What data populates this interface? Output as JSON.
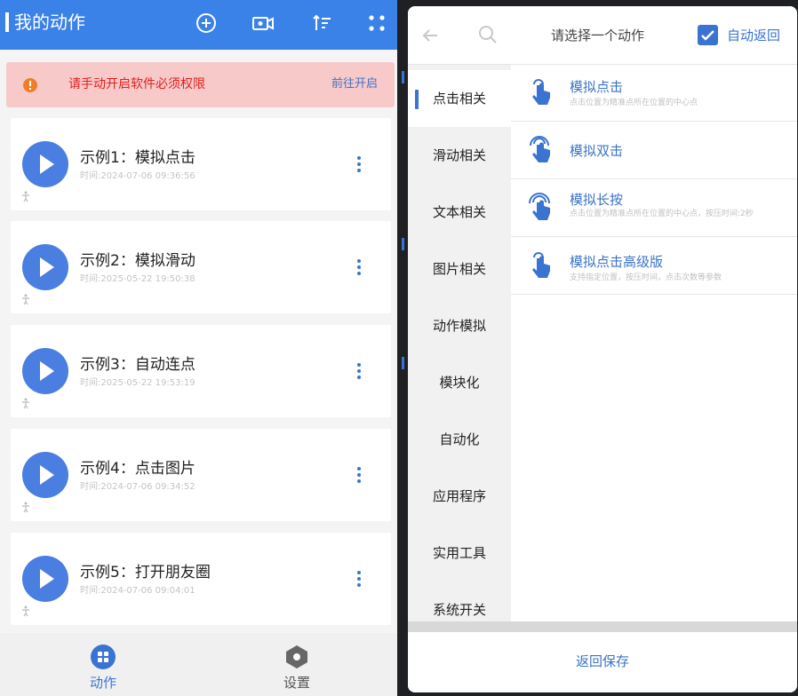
{
  "left": {
    "header": {
      "title": "我的动作",
      "icons": [
        "plus-circle-icon",
        "record-video-icon",
        "sort-icon",
        "grid-dots-icon"
      ]
    },
    "warning": {
      "icon": "exclamation-icon",
      "text": "请手动开启软件必须权限",
      "link": "前往开启",
      "colors": {
        "background": "#f8c9c9",
        "text": "#e0201f",
        "link": "#3b74c4"
      }
    },
    "tasks": [
      {
        "title": "示例1：模拟点击",
        "time": "时间:2024-07-06 09:36:56"
      },
      {
        "title": "示例2：模拟滑动",
        "time": "时间:2025-05-22 19:50:38"
      },
      {
        "title": "示例3：自动连点",
        "time": "时间:2025-05-22 19:53:19"
      },
      {
        "title": "示例4：点击图片",
        "time": "时间:2024-07-06 09:34:52"
      },
      {
        "title": "示例5：打开朋友圈",
        "time": "时间:2024-07-06 09:04:01"
      }
    ],
    "nav": [
      {
        "label": "动作",
        "icon": "actions-grid-icon",
        "active": true
      },
      {
        "label": "设置",
        "icon": "settings-hex-icon",
        "active": false
      }
    ],
    "colors": {
      "brand": "#3b82e8",
      "play": "#4a7ee0"
    }
  },
  "right": {
    "header": {
      "title": "请选择一个动作",
      "auto_return_label": "自动返回",
      "auto_return_checked": true
    },
    "categories": [
      {
        "label": "点击相关",
        "active": true
      },
      {
        "label": "滑动相关",
        "active": false
      },
      {
        "label": "文本相关",
        "active": false
      },
      {
        "label": "图片相关",
        "active": false
      },
      {
        "label": "动作模拟",
        "active": false
      },
      {
        "label": "模块化",
        "active": false
      },
      {
        "label": "自动化",
        "active": false
      },
      {
        "label": "应用程序",
        "active": false
      },
      {
        "label": "实用工具",
        "active": false
      },
      {
        "label": "系统开关",
        "active": false
      }
    ],
    "actions": [
      {
        "title": "模拟点击",
        "desc": "点击位置为精准点所在位置的中心点",
        "icon": "tap-finger-icon"
      },
      {
        "title": "模拟双击",
        "desc": "",
        "icon": "double-tap-finger-icon"
      },
      {
        "title": "模拟长按",
        "desc": "点击位置为精准点所在位置的中心点，按压时间:2秒",
        "icon": "long-press-finger-icon"
      },
      {
        "title": "模拟点击高级版",
        "desc": "支持指定位置，按压时间，点击次数等参数",
        "icon": "tap-finger-icon"
      }
    ],
    "footer": {
      "save_label": "返回保存"
    },
    "colors": {
      "accent": "#3b74d0"
    }
  }
}
